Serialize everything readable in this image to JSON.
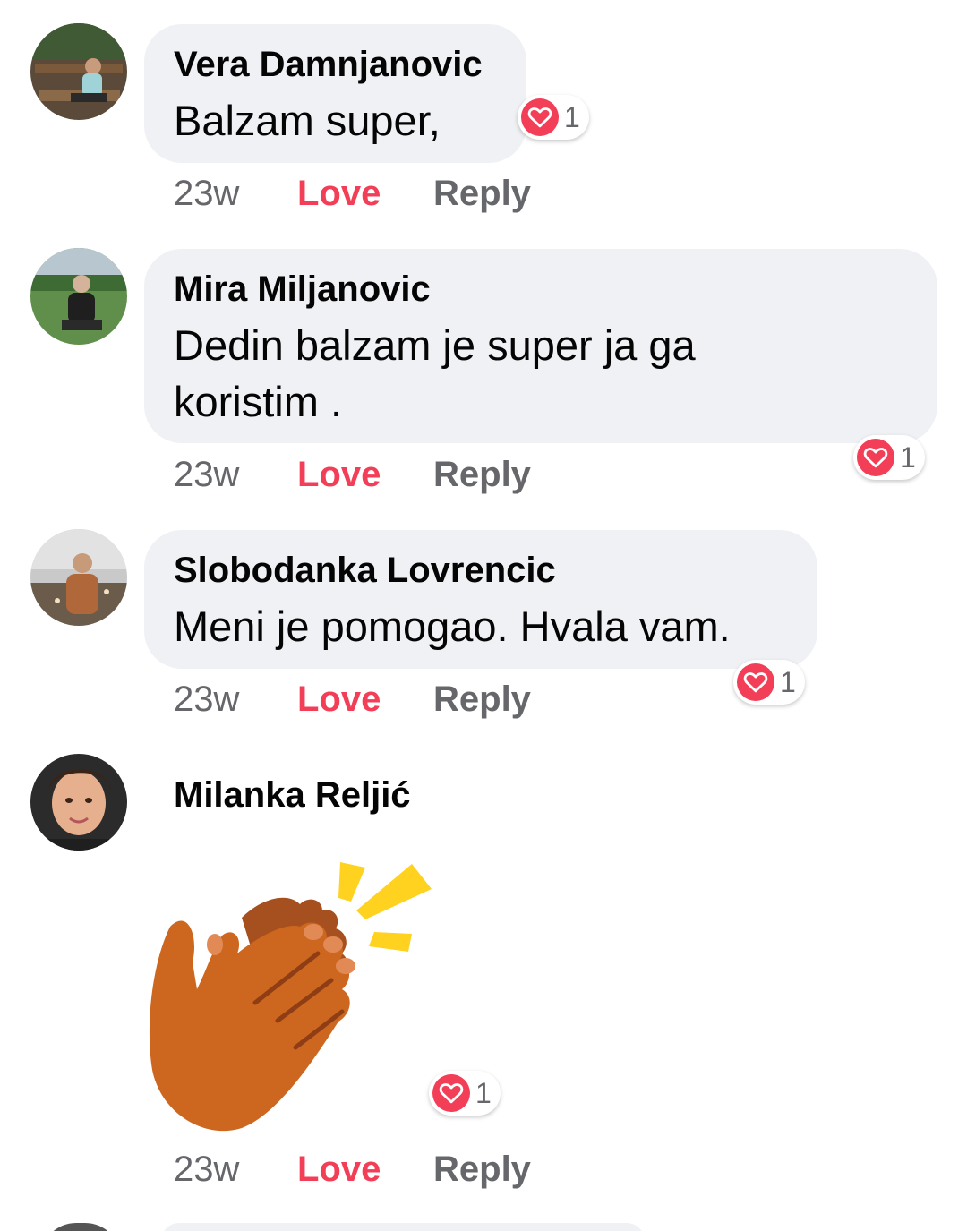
{
  "comments": [
    {
      "author": "Vera Damnjanovic",
      "text_lines": [
        "Balzam super,"
      ],
      "reaction_count": "1",
      "time": "23w",
      "love_label": "Love",
      "reply_label": "Reply"
    },
    {
      "author": "Mira Miljanovic",
      "text_lines": [
        "Dedin balzam je super ja ga",
        "koristim ."
      ],
      "reaction_count": "1",
      "time": "23w",
      "love_label": "Love",
      "reply_label": "Reply"
    },
    {
      "author": "Slobodanka Lovrencic",
      "text_lines": [
        "Meni je pomogao. Hvala vam."
      ],
      "reaction_count": "1",
      "time": "23w",
      "love_label": "Love",
      "reply_label": "Reply"
    },
    {
      "author": "Milanka Reljić",
      "sticker": "clapping-hands-sticker",
      "reaction_count": "1",
      "time": "23w",
      "love_label": "Love",
      "reply_label": "Reply"
    }
  ],
  "colors": {
    "bubble_bg": "#eff1f4",
    "love_red": "#f33e58",
    "meta_gray": "#65676b",
    "text": "#050505"
  },
  "icons": {
    "reaction": "heart-icon",
    "sticker": "clapping-hands-icon"
  }
}
